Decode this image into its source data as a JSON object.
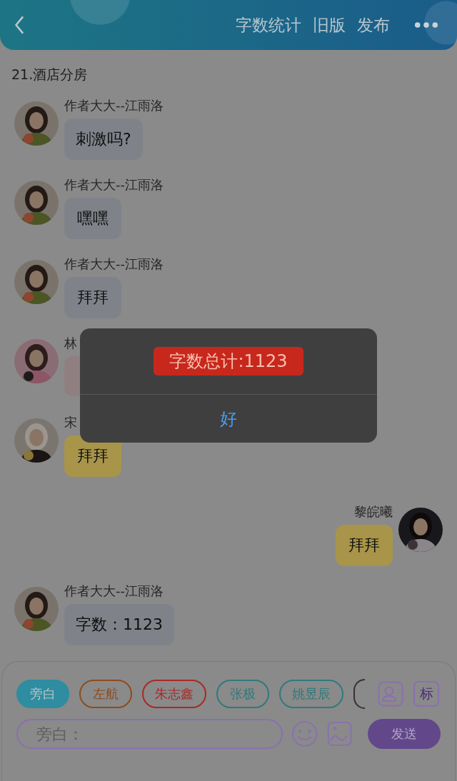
{
  "header": {
    "actions": [
      "字数统计",
      "旧版",
      "发布"
    ]
  },
  "chapter_title": "21.酒店分房",
  "messages": [
    {
      "kind": "incoming",
      "name": "作者大大--江雨洛",
      "text": "刺激吗?",
      "color": "#7f8389"
    },
    {
      "kind": "incoming",
      "name": "作者大大--江雨洛",
      "text": "嘿嘿",
      "color": "#7f8389"
    },
    {
      "kind": "incoming",
      "name": "作者大大--江雨洛",
      "text": "拜拜",
      "color": "#7f8389"
    },
    {
      "kind": "incoming",
      "name": "林",
      "color": "#8f7f80"
    },
    {
      "kind": "incoming",
      "name": "宋",
      "text": "拜拜",
      "color": "#a8954a"
    },
    {
      "kind": "outgoing",
      "name": "黎皖曦",
      "text": "拜拜",
      "color": "#a8954a"
    },
    {
      "kind": "incoming",
      "name": "作者大大--江雨洛",
      "text": "字数：1123",
      "color": "#7f8389"
    }
  ],
  "roles": [
    {
      "label": "旁白",
      "selected": true,
      "color": "#2e8da0"
    },
    {
      "label": "左航",
      "selected": false,
      "color": "#8e4c1c"
    },
    {
      "label": "朱志鑫",
      "selected": false,
      "color": "#a82a25"
    },
    {
      "label": "张极",
      "selected": false,
      "color": "#2f7a7b"
    },
    {
      "label": "姚昱辰",
      "selected": false,
      "color": "#2f7a7b"
    }
  ],
  "composer": {
    "tag_button": "标",
    "placeholder": "旁白：",
    "send": "发送"
  },
  "dialog": {
    "message": "字数总计:1123",
    "button": "好"
  }
}
